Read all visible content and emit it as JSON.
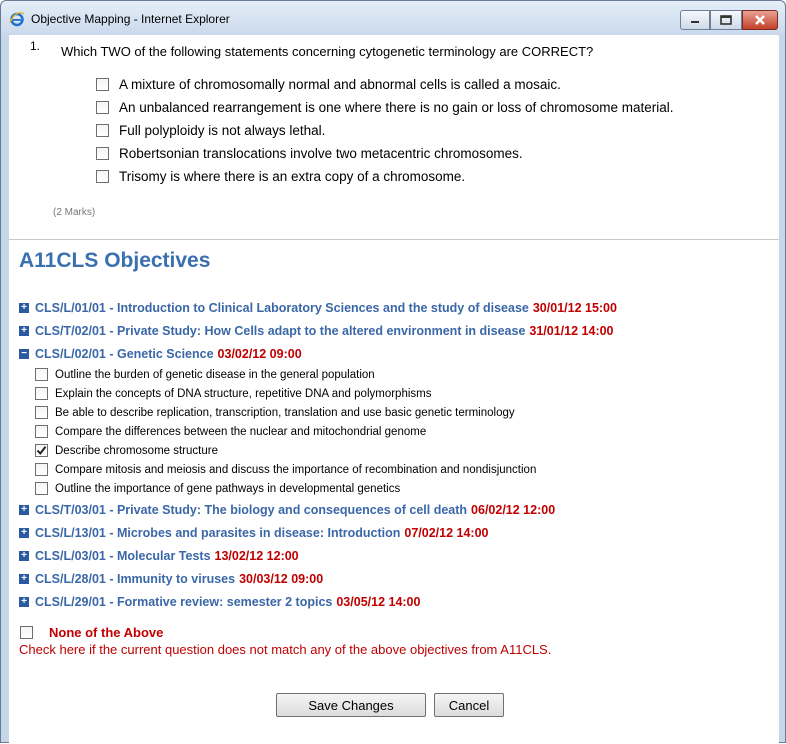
{
  "window": {
    "title": "Objective Mapping - Internet Explorer"
  },
  "question": {
    "number": "1.",
    "text": "Which TWO of the following statements concerning cytogenetic terminology are CORRECT?",
    "options": [
      {
        "label": "A mixture of chromosomally normal and abnormal cells is called a mosaic.",
        "checked": false
      },
      {
        "label": "An unbalanced rearrangement is one where there is no gain or loss of chromosome material.",
        "checked": false
      },
      {
        "label": "Full polyploidy is not always lethal.",
        "checked": false
      },
      {
        "label": "Robertsonian translocations involve two metacentric chromosomes.",
        "checked": false
      },
      {
        "label": "Trisomy is where there is an extra copy of a chromosome.",
        "checked": false
      }
    ],
    "marks": "(2 Marks)"
  },
  "objectives": {
    "heading": "A11CLS Objectives",
    "items": [
      {
        "label": "CLS/L/01/01 - Introduction to Clinical Laboratory Sciences and the study of disease",
        "date": "30/01/12 15:00",
        "expander": "+"
      },
      {
        "label": "CLS/T/02/01 - Private Study: How Cells adapt to the altered environment in disease",
        "date": "31/01/12 14:00",
        "expander": "+"
      },
      {
        "label": "CLS/L/02/01 - Genetic Science",
        "date": "03/02/12 09:00",
        "expander": "−",
        "subitems": [
          {
            "label": "Outline the burden of genetic disease in the general population",
            "checked": false
          },
          {
            "label": "Explain the concepts of DNA structure, repetitive DNA and polymorphisms",
            "checked": false
          },
          {
            "label": "Be able to describe replication, transcription, translation and use basic genetic terminology",
            "checked": false
          },
          {
            "label": "Compare the differences between the nuclear and mitochondrial genome",
            "checked": false
          },
          {
            "label": "Describe chromosome structure",
            "checked": true
          },
          {
            "label": "Compare mitosis and meiosis and discuss the importance of recombination and nondisjunction",
            "checked": false
          },
          {
            "label": "Outline the importance of gene pathways in developmental genetics",
            "checked": false
          }
        ]
      },
      {
        "label": "CLS/T/03/01 - Private Study: The biology and consequences of cell death",
        "date": "06/02/12 12:00",
        "expander": "+"
      },
      {
        "label": "CLS/L/13/01 - Microbes and parasites in disease: Introduction",
        "date": "07/02/12 14:00",
        "expander": "+"
      },
      {
        "label": "CLS/L/03/01 - Molecular Tests",
        "date": "13/02/12 12:00",
        "expander": "+"
      },
      {
        "label": "CLS/L/28/01 - Immunity to viruses",
        "date": "30/03/12 09:00",
        "expander": "+"
      },
      {
        "label": "CLS/L/29/01 - Formative review: semester 2 topics",
        "date": "03/05/12 14:00",
        "expander": "+"
      }
    ],
    "none": {
      "label": "None of the Above",
      "help": "Check here if the current question does not match any of the above objectives from A11CLS.",
      "checked": false
    }
  },
  "buttons": {
    "save": "Save Changes",
    "cancel": "Cancel"
  },
  "colors": {
    "objective_blue": "#3a67a8",
    "date_red": "#c00000",
    "heading_blue": "#3a70b0"
  },
  "icons": {
    "browser": "ie-icon",
    "expand": "expand-plus-icon",
    "collapse": "collapse-minus-icon",
    "check": "checkmark-icon"
  }
}
